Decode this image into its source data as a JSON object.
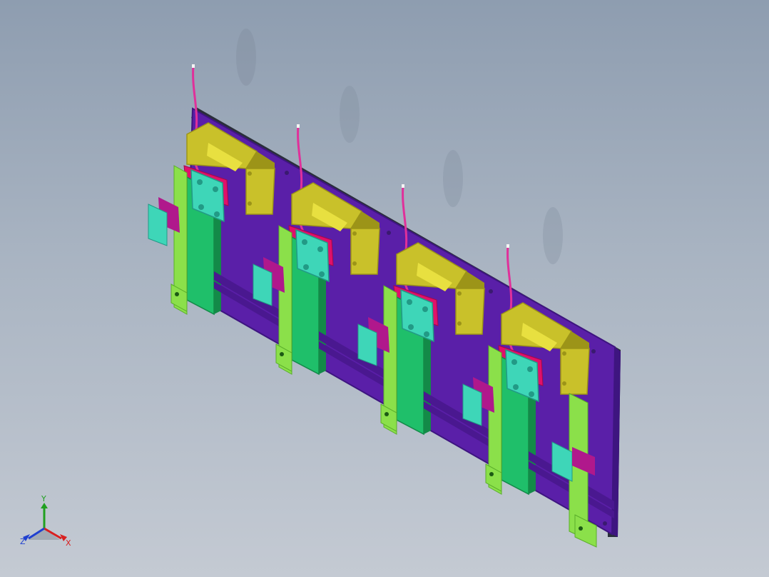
{
  "viewport": {
    "background_top": "#8e9db0",
    "background_bottom": "#c4cad3",
    "model_colors": {
      "base_plate": "#5a1fa8",
      "base_plate_dark": "#3e1580",
      "main_bar": "#1fbf6a",
      "main_bar_dark": "#138a48",
      "side_arm": "#8be04a",
      "side_arm_dark": "#5aae2a",
      "clamp_block": "#c9c12a",
      "clamp_block_dark": "#9c9418",
      "slider": "#e0106a",
      "pad": "#3ed6b8",
      "pad_dark": "#229a86",
      "gripper": "#b0188c",
      "cable": "#e0309a"
    },
    "station_count": 4
  },
  "triad": {
    "x_label": "X",
    "y_label": "Y",
    "z_label": "Z",
    "x_color": "#d82020",
    "y_color": "#20a020",
    "z_color": "#2040d0"
  }
}
